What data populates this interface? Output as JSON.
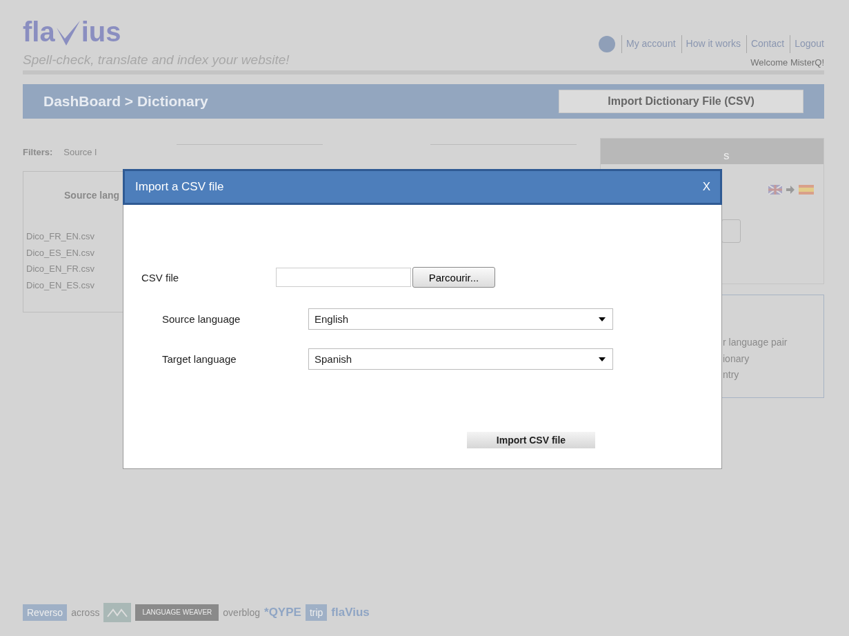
{
  "header": {
    "logo": {
      "left": "fla",
      "right": "ius"
    },
    "tagline": "Spell-check, translate and index your website!",
    "nav": [
      "My account",
      "How it works",
      "Contact",
      "Logout"
    ],
    "welcome": "Welcome MisterQ!"
  },
  "breadcrumb": "DashBoard > Dictionary",
  "import_button": "Import Dictionary File (CSV)",
  "filters": {
    "label": "Filters:",
    "source_label": "Source l"
  },
  "file_list": {
    "heading": "Source lang",
    "files": [
      "Dico_FR_EN.csv",
      "Dico_ES_EN.csv",
      "Dico_EN_FR.csv",
      "Dico_EN_ES.csv"
    ]
  },
  "side_panel": {
    "title": "s"
  },
  "help_panel": {
    "lines": [
      "r language pair",
      "ionary",
      "ntry"
    ]
  },
  "partners": [
    {
      "kind": "boxed",
      "text": "Reverso"
    },
    {
      "kind": "plain",
      "text": "across"
    },
    {
      "kind": "mark"
    },
    {
      "kind": "dark",
      "text": "LANGUAGE WEAVER"
    },
    {
      "kind": "plain",
      "text": "overblog"
    },
    {
      "kind": "bold",
      "text": "*QYPE"
    },
    {
      "kind": "boxed",
      "text": "trip"
    },
    {
      "kind": "bold",
      "text": "flaVius"
    }
  ],
  "dialog": {
    "title": "Import a CSV file",
    "close": "X",
    "file_label": "CSV file",
    "browse": "Parcourir...",
    "source_label": "Source language",
    "source_value": "English",
    "target_label": "Target language",
    "target_value": "Spanish",
    "submit": "Import CSV file"
  }
}
